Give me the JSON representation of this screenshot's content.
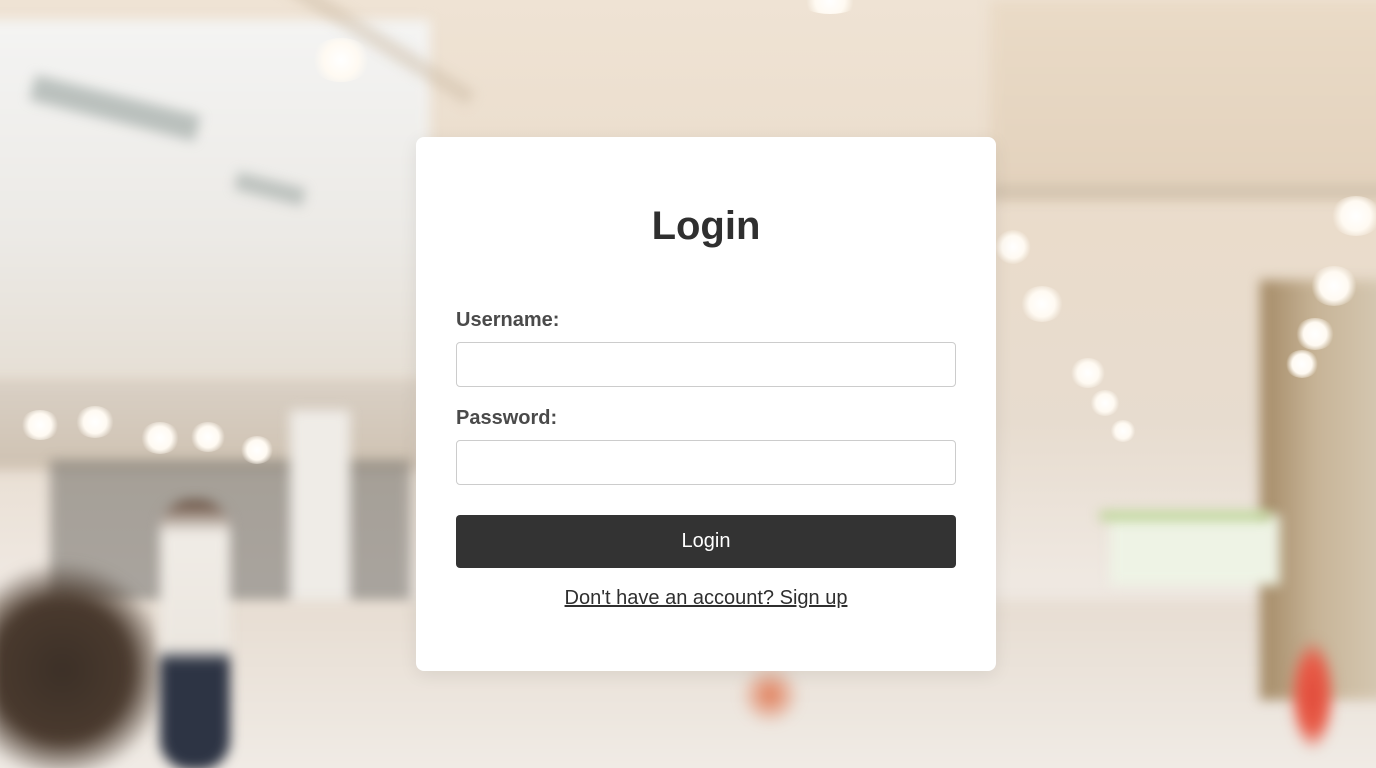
{
  "login": {
    "title": "Login",
    "username_label": "Username:",
    "username_value": "",
    "password_label": "Password:",
    "password_value": "",
    "submit_label": "Login",
    "signup_link": "Don't have an account? Sign up"
  },
  "colors": {
    "card_background": "#ffffff",
    "button_background": "#333333",
    "button_text": "#ffffff",
    "title_text": "#2f2f2f",
    "label_text": "#4a4a4a",
    "input_border": "#cccccc"
  },
  "background": {
    "description_icon": "blurred-mall-photo"
  }
}
